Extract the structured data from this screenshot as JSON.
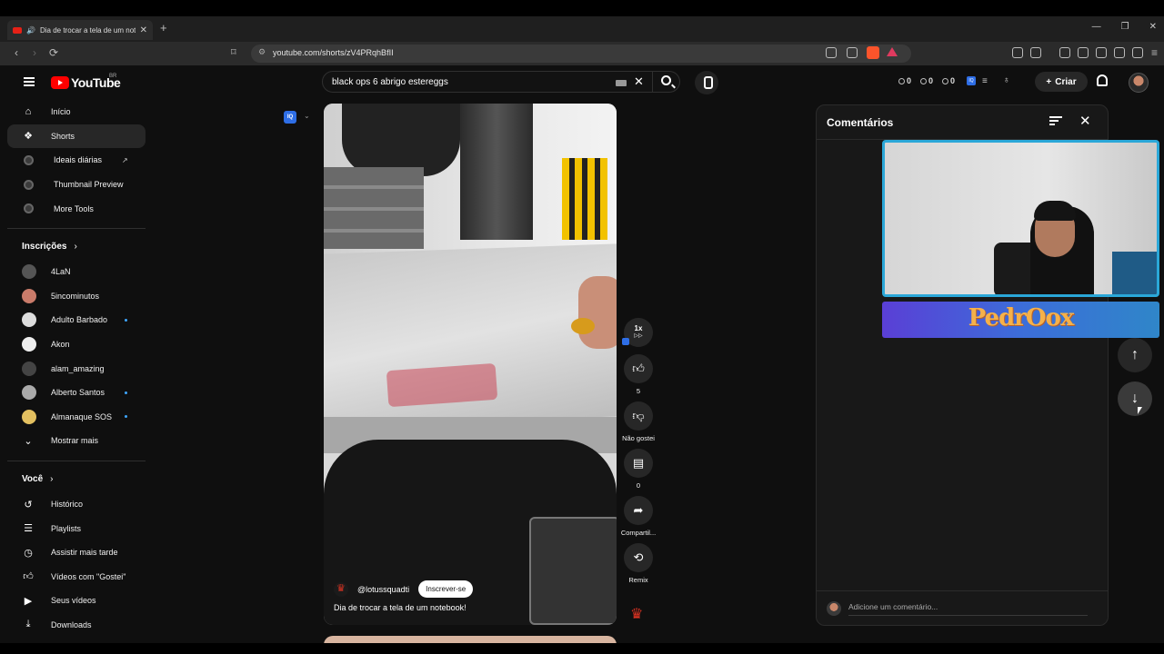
{
  "browser": {
    "tab_title": "Dia de trocar a tela de um notebook! - YouTube",
    "url": "youtube.com/shorts/zV4PRqhBfII"
  },
  "header": {
    "logo_text": "YouTube",
    "region": "BR",
    "search_value": "black ops 6 abrigo estereggs",
    "counters": [
      "0",
      "0",
      "0"
    ],
    "iq_label": "IQ",
    "create_label": "Criar"
  },
  "sidebar": {
    "main_items": [
      {
        "label": "Início",
        "icon": "home-icon"
      },
      {
        "label": "Shorts",
        "icon": "shorts-icon",
        "active": true
      },
      {
        "label": "Ideais diárias",
        "icon": "tool-icon"
      },
      {
        "label": "Thumbnail Preview",
        "icon": "tool-icon"
      },
      {
        "label": "More Tools",
        "icon": "tool-icon"
      }
    ],
    "subscriptions_title": "Inscrições",
    "subscriptions": [
      {
        "label": "4LaN",
        "color": "#555555"
      },
      {
        "label": "5incominutos",
        "color": "#c97b6a"
      },
      {
        "label": "Adulto Barbado",
        "color": "#dddddd",
        "live": true
      },
      {
        "label": "Akon",
        "color": "#eeeeee"
      },
      {
        "label": "alam_amazing",
        "color": "#444444"
      },
      {
        "label": "Alberto Santos",
        "color": "#aaaaaa",
        "live": true
      },
      {
        "label": "Almanaque SOS",
        "color": "#e3c060",
        "live": true
      }
    ],
    "show_more": "Mostrar mais",
    "you_title": "Você",
    "you_items": [
      {
        "label": "Histórico",
        "icon": "history-icon"
      },
      {
        "label": "Playlists",
        "icon": "playlist-icon"
      },
      {
        "label": "Assistir mais tarde",
        "icon": "clock-icon"
      },
      {
        "label": "Vídeos com \"Gostei\"",
        "icon": "thumbs-up-icon"
      },
      {
        "label": "Seus vídeos",
        "icon": "video-icon"
      },
      {
        "label": "Downloads",
        "icon": "download-icon"
      }
    ]
  },
  "short": {
    "channel": "@lotussquadti",
    "subscribe": "Inscrever-se",
    "caption": "Dia de trocar a tela de um notebook!",
    "speed_label": "1x",
    "likes": "5",
    "dislike_label": "Não gostei",
    "comments_count": "0",
    "share_label": "Compartil...",
    "remix_label": "Remix"
  },
  "comments": {
    "title": "Comentários",
    "input_placeholder": "Adicione um comentário..."
  },
  "overlay": {
    "banner_text": "PedrOox"
  },
  "colors": {
    "accent": "#ff0000",
    "cam_border": "#2aa7d8",
    "live_dot": "#3ea6ff"
  }
}
